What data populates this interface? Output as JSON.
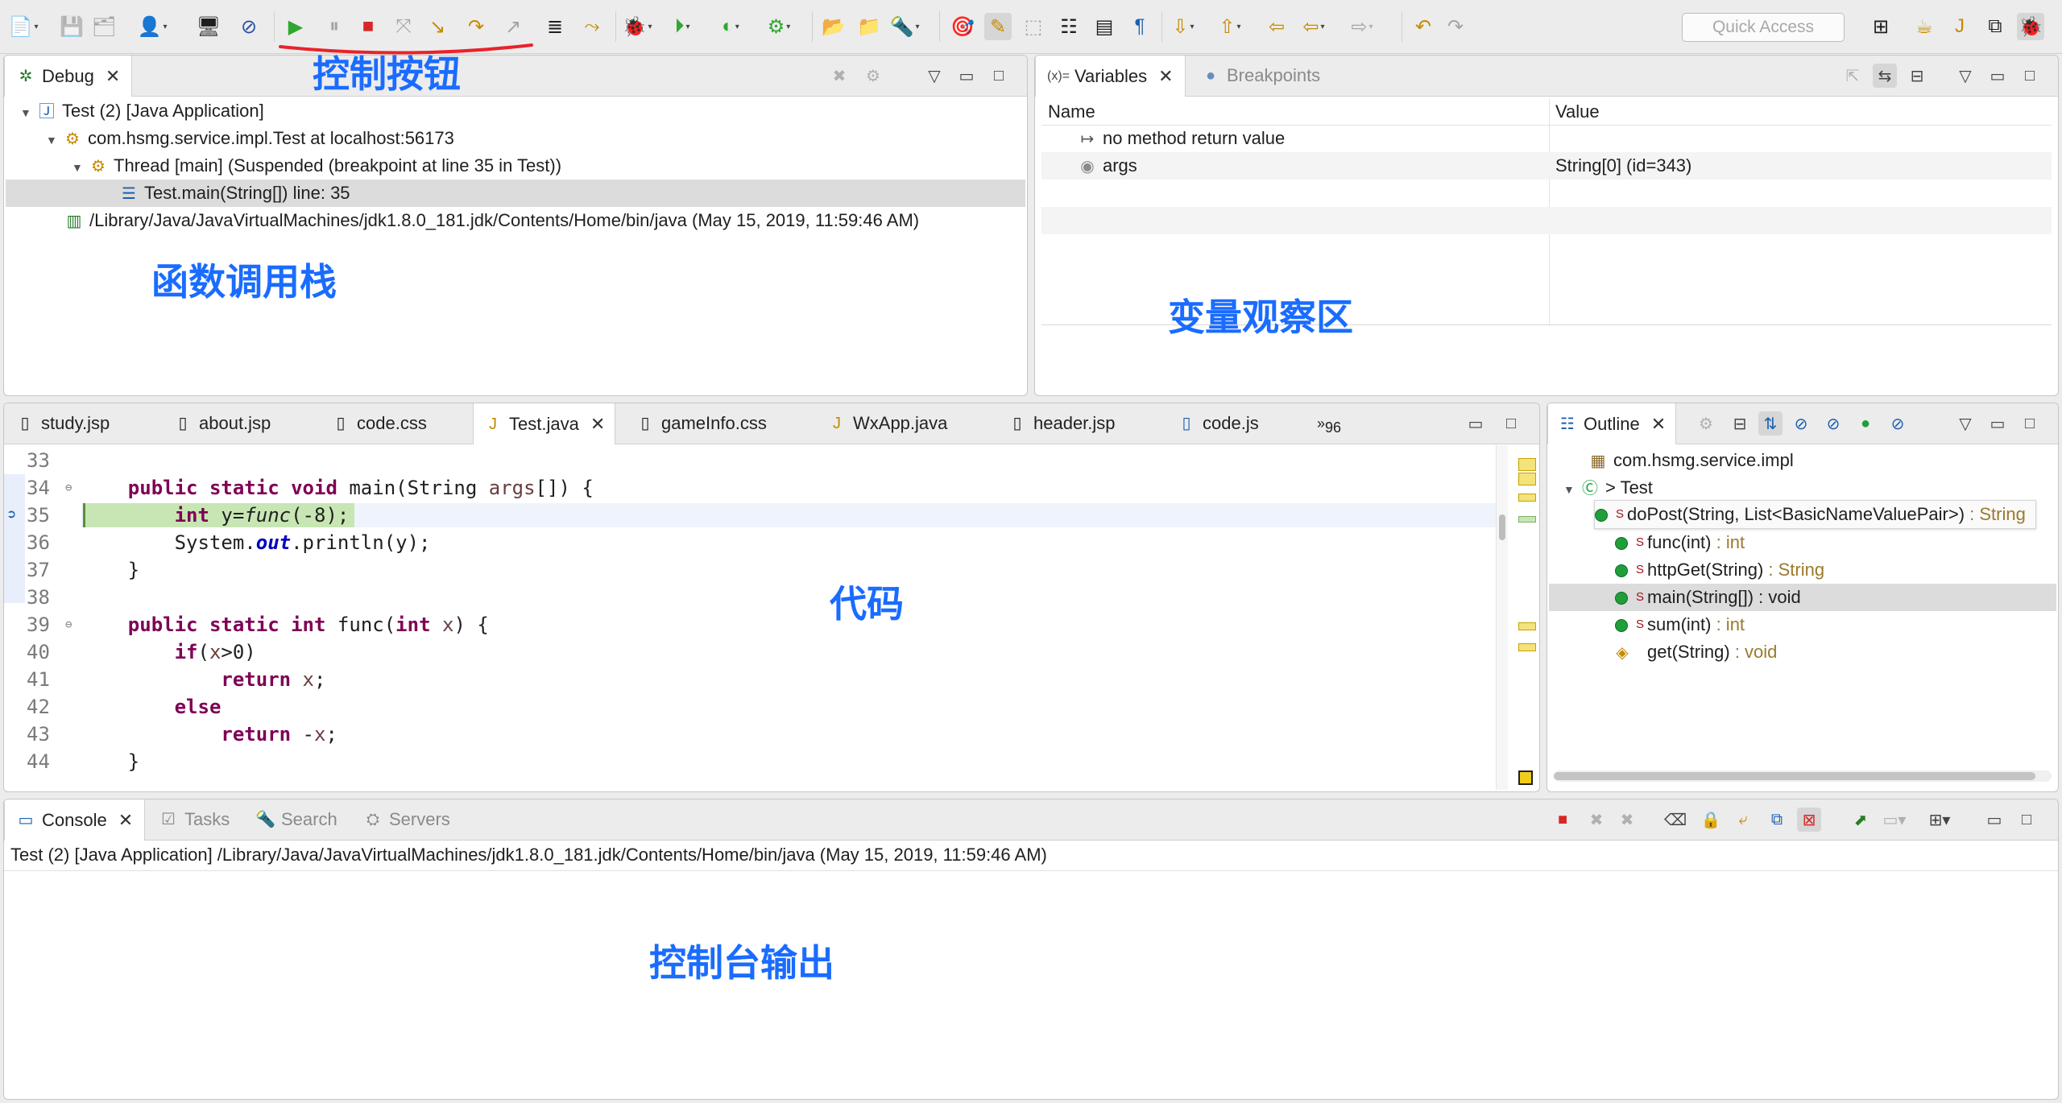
{
  "toolbar": {
    "quick_access_placeholder": "Quick Access"
  },
  "annotations": {
    "controls": "控制按钮",
    "call_stack": "函数调用栈",
    "variables": "变量观察区",
    "code": "代码",
    "console": "控制台输出"
  },
  "debug_view": {
    "tab_label": "Debug",
    "tree": [
      "Test (2) [Java Application]",
      "com.hsmg.service.impl.Test at localhost:56173",
      "Thread [main] (Suspended (breakpoint at line 35 in Test))",
      "Test.main(String[]) line: 35",
      "/Library/Java/JavaVirtualMachines/jdk1.8.0_181.jdk/Contents/Home/bin/java (May 15, 2019, 11:59:46 AM)"
    ]
  },
  "variables_view": {
    "tabs": [
      "Variables",
      "Breakpoints"
    ],
    "variables_icon_text": "(x)=",
    "columns": [
      "Name",
      "Value"
    ],
    "rows": [
      {
        "name": "no method return value",
        "value": ""
      },
      {
        "name": "args",
        "value": "String[0]  (id=343)"
      }
    ]
  },
  "editor": {
    "tabs": [
      "study.jsp",
      "about.jsp",
      "code.css",
      "Test.java",
      "gameInfo.css",
      "WxApp.java",
      "header.jsp",
      "code.js"
    ],
    "overflow_count": "96",
    "active_tab": "Test.java",
    "current_line": 35,
    "lines": [
      {
        "n": "33",
        "tokens": []
      },
      {
        "n": "34",
        "fold": true,
        "tokens": [
          [
            "    ",
            ""
          ],
          [
            "public",
            "kw"
          ],
          [
            " ",
            ""
          ],
          [
            "static",
            "kw"
          ],
          [
            " ",
            ""
          ],
          [
            "void",
            "kw"
          ],
          [
            " main(String ",
            ""
          ],
          [
            "args",
            "var"
          ],
          [
            "[]) {",
            ""
          ]
        ]
      },
      {
        "n": "35",
        "tokens": [
          [
            "        ",
            ""
          ],
          [
            "int",
            "kw"
          ],
          [
            " y=",
            ""
          ],
          [
            "func",
            "ital"
          ],
          [
            "(-8);",
            ""
          ]
        ]
      },
      {
        "n": "36",
        "tokens": [
          [
            "        System.",
            ""
          ],
          [
            "out",
            "fld"
          ],
          [
            ".println(y);",
            ""
          ]
        ]
      },
      {
        "n": "37",
        "tokens": [
          [
            "    }",
            ""
          ]
        ]
      },
      {
        "n": "38",
        "tokens": []
      },
      {
        "n": "39",
        "fold": true,
        "tokens": [
          [
            "    ",
            ""
          ],
          [
            "public",
            "kw"
          ],
          [
            " ",
            ""
          ],
          [
            "static",
            "kw"
          ],
          [
            " ",
            ""
          ],
          [
            "int",
            "kw"
          ],
          [
            " func(",
            ""
          ],
          [
            "int",
            "kw"
          ],
          [
            " ",
            ""
          ],
          [
            "x",
            "var"
          ],
          [
            ") {",
            ""
          ]
        ]
      },
      {
        "n": "40",
        "tokens": [
          [
            "        ",
            ""
          ],
          [
            "if",
            "kw"
          ],
          [
            "(",
            ""
          ],
          [
            "x",
            "var"
          ],
          [
            ">0)",
            ""
          ]
        ]
      },
      {
        "n": "41",
        "tokens": [
          [
            "            ",
            ""
          ],
          [
            "return",
            "kw"
          ],
          [
            " ",
            ""
          ],
          [
            "x",
            "var"
          ],
          [
            ";",
            ""
          ]
        ]
      },
      {
        "n": "42",
        "tokens": [
          [
            "        ",
            ""
          ],
          [
            "else",
            "kw"
          ]
        ]
      },
      {
        "n": "43",
        "tokens": [
          [
            "            ",
            ""
          ],
          [
            "return",
            "kw"
          ],
          [
            " -",
            ""
          ],
          [
            "x",
            "var"
          ],
          [
            ";",
            ""
          ]
        ]
      },
      {
        "n": "44",
        "tokens": [
          [
            "    }",
            ""
          ]
        ]
      }
    ]
  },
  "outline_view": {
    "tab_label": "Outline",
    "package": "com.hsmg.service.impl",
    "class": "> Test",
    "members": [
      {
        "static": "S",
        "name": "doPost(String, List<BasicNameValuePair>)",
        "type": " : String"
      },
      {
        "static": "S",
        "name": "func(int)",
        "type": " : int"
      },
      {
        "static": "S",
        "name": "httpGet(String)",
        "type": " : String"
      },
      {
        "static": "S",
        "name": "main(String[]) : void",
        "type": ""
      },
      {
        "static": "S",
        "name": "sum(int)",
        "type": " : int"
      },
      {
        "static": "",
        "name": "get(String)",
        "type": " : void"
      }
    ]
  },
  "console_view": {
    "tabs": [
      "Console",
      "Tasks",
      "Search",
      "Servers"
    ],
    "header": "Test (2) [Java Application] /Library/Java/JavaVirtualMachines/jdk1.8.0_181.jdk/Contents/Home/bin/java (May 15, 2019, 11:59:46 AM)"
  },
  "colors": {
    "annotation": "#1a6cff",
    "keyword": "#7f0055",
    "current_line": "#c8e6b4",
    "selection": "#dcdcdc",
    "underline": "#e8232a"
  }
}
